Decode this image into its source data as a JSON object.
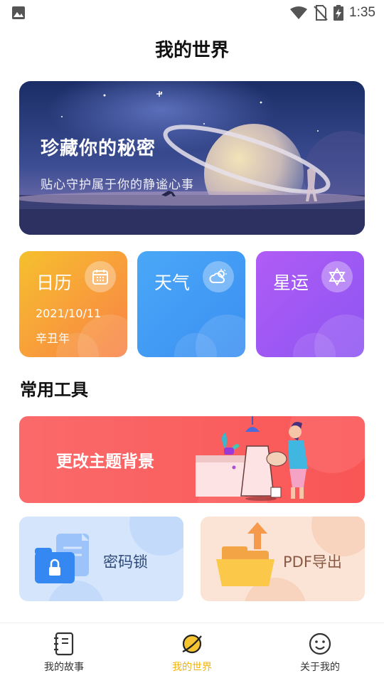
{
  "status_bar": {
    "time": "1:35",
    "icons": [
      "gallery-icon",
      "wifi-icon",
      "no-sim-icon",
      "battery-charging-icon"
    ]
  },
  "page": {
    "title": "我的世界"
  },
  "hero": {
    "title": "珍藏你的秘密",
    "subtitle": "贴心守护属于你的静谧心事"
  },
  "cards": [
    {
      "title": "日历",
      "icon": "calendar-icon",
      "date": "2021/10/11",
      "year": "辛丑年",
      "color": "#f7a136"
    },
    {
      "title": "天气",
      "icon": "cloud-sun-icon",
      "color": "#3f98f5"
    },
    {
      "title": "星运",
      "icon": "star-of-david-icon",
      "color": "#9a57f3"
    }
  ],
  "tools": {
    "section_title": "常用工具",
    "theme_label": "更改主题背景",
    "lock_label": "密码锁",
    "pdf_label": "PDF导出"
  },
  "bottom_nav": {
    "items": [
      {
        "label": "我的故事",
        "icon": "notebook-icon",
        "active": false
      },
      {
        "label": "我的世界",
        "icon": "planet-icon",
        "active": true
      },
      {
        "label": "关于我的",
        "icon": "smiley-icon",
        "active": false
      }
    ],
    "active_color": "#f2b30d"
  }
}
